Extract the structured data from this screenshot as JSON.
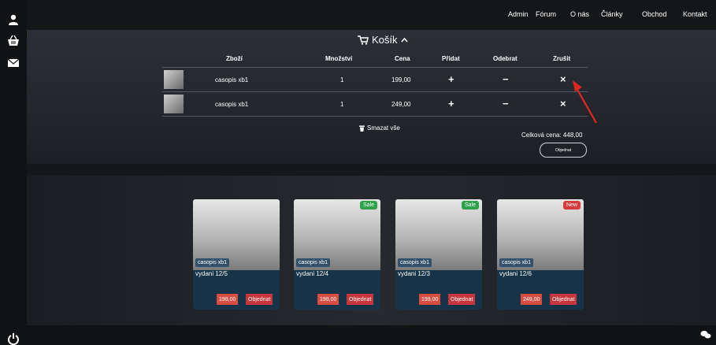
{
  "nav": {
    "items": [
      "Admin",
      "Fórum",
      "O nás",
      "Články",
      "Obchod",
      "Kontakt"
    ]
  },
  "cart": {
    "title": "Košík",
    "headers": {
      "item": "Zboží",
      "qty": "Množství",
      "price": "Cena",
      "add": "Přidat",
      "remove": "Odebrat",
      "cancel": "Zrušit"
    },
    "rows": [
      {
        "name": "casopis xb1",
        "qty": "1",
        "price": "199,00",
        "add": "+",
        "remove": "−",
        "cancel": "×"
      },
      {
        "name": "casopis xb1",
        "qty": "1",
        "price": "249,00",
        "add": "+",
        "remove": "−",
        "cancel": "×"
      }
    ],
    "clear_label": "Smazat vše",
    "total_label": "Celková cena: 448,00",
    "order_label": "Objednat"
  },
  "products": [
    {
      "badge": "",
      "tag": "casopis xb1",
      "edition": "vydani 12/5",
      "price": "199,00",
      "order": "Objednat"
    },
    {
      "badge": "Sale",
      "tag": "casopis xb1",
      "edition": "vydani 12/4",
      "price": "199,00",
      "order": "Objednat"
    },
    {
      "badge": "Sale",
      "tag": "casopis xb1",
      "edition": "vydani 12/3",
      "price": "199,00",
      "order": "Objednat"
    },
    {
      "badge": "New",
      "tag": "casopis xb1",
      "edition": "vydani 12/6",
      "price": "249,00",
      "order": "Objednat"
    }
  ],
  "icons": {
    "user": "user-icon",
    "basket": "basket-icon",
    "mail": "mail-icon",
    "power": "power-icon",
    "chat": "chat-icon",
    "cart": "cart-icon",
    "trash": "trash-icon",
    "chevron": "chevron-up-icon"
  },
  "colors": {
    "sale": "#2ea14a",
    "new": "#d63a3a",
    "price": "#d94d43",
    "order": "#c7363a",
    "arrow": "#e0281e"
  }
}
